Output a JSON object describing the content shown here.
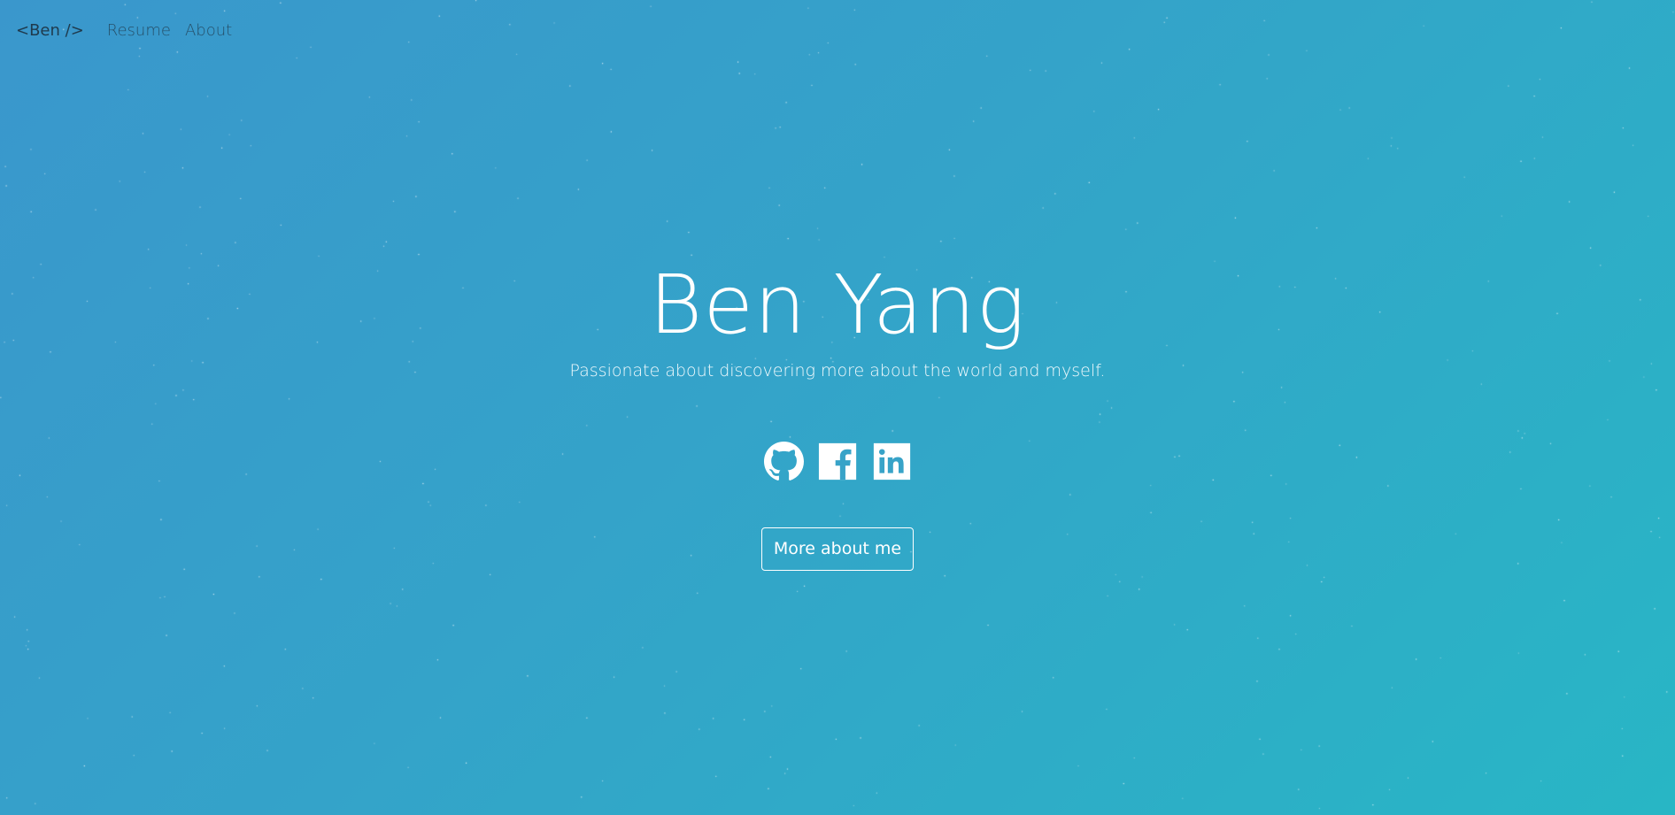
{
  "nav": {
    "brand": "<Ben />",
    "links": [
      "Resume",
      "About"
    ]
  },
  "hero": {
    "title": "Ben Yang",
    "tagline": "Passionate about discovering more about the world and myself."
  },
  "social": [
    {
      "icon": "github-icon"
    },
    {
      "icon": "facebook-icon"
    },
    {
      "icon": "linkedin-icon"
    }
  ],
  "cta": {
    "label": "More about me"
  },
  "colors": {
    "gradient_start": "#3a97cc",
    "gradient_end": "#28b6c5",
    "text": "#ffffff",
    "nav_text": "#26506a"
  }
}
